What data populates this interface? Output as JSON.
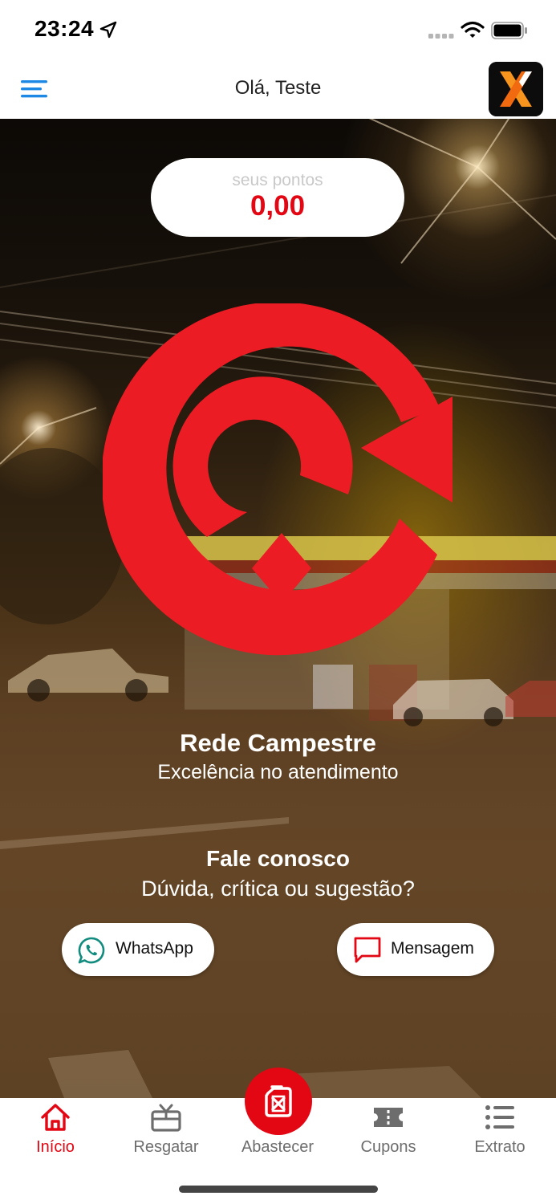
{
  "status_bar": {
    "time": "23:24"
  },
  "header": {
    "greeting": "Olá, Teste"
  },
  "points": {
    "label": "seus pontos",
    "value": "0,00"
  },
  "company": {
    "name": "Rede Campestre",
    "tagline": "Excelência no atendimento"
  },
  "contact": {
    "title": "Fale conosco",
    "subtitle": "Dúvida, crítica ou sugestão?"
  },
  "buttons": {
    "whatsapp": "WhatsApp",
    "message": "Mensagem"
  },
  "tabs": [
    {
      "label": "Início",
      "icon": "home-icon",
      "active": true
    },
    {
      "label": "Resgatar",
      "icon": "gift-icon",
      "active": false
    },
    {
      "label": "Abastecer",
      "icon": "fuel-can-icon",
      "active": false
    },
    {
      "label": "Cupons",
      "icon": "ticket-icon",
      "active": false
    },
    {
      "label": "Extrato",
      "icon": "list-icon",
      "active": false
    }
  ],
  "colors": {
    "accent": "#e30613",
    "whatsapp": "#128c7e",
    "menu": "#1e88e5",
    "tab_inactive": "#6d6d6d"
  }
}
